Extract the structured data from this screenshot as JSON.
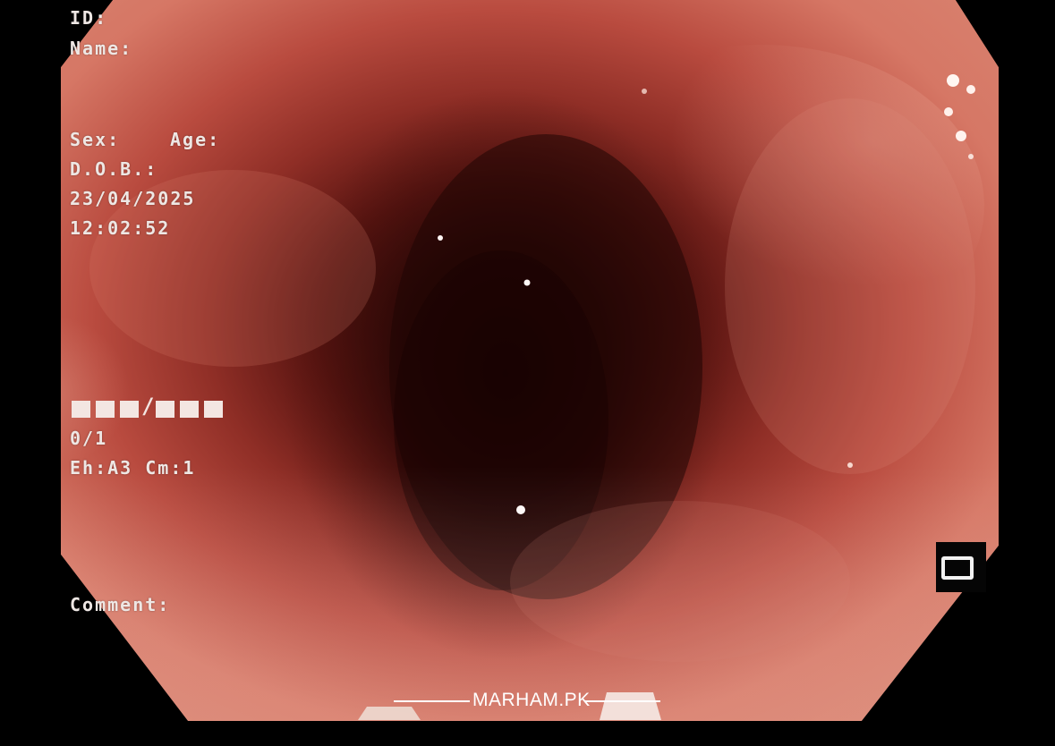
{
  "overlay": {
    "id_label": "ID:",
    "name_label": "Name:",
    "sex_label": "Sex:",
    "age_label": "Age:",
    "dob_label": "D.O.B.:",
    "date": "23/04/2025",
    "time": "12:02:52",
    "status": "0/1",
    "mode": "Eh:A3 Cm:1",
    "comment_label": "Comment:"
  },
  "watermark": {
    "text": "MARHAM.PK"
  },
  "colors": {
    "background": "#000000",
    "text": "#eee7e4",
    "mucosa_light": "#d67765",
    "mucosa_mid": "#b94b3f",
    "lumen_dark": "#260605"
  },
  "icons": {
    "frame_indicator": "frame-icon"
  }
}
